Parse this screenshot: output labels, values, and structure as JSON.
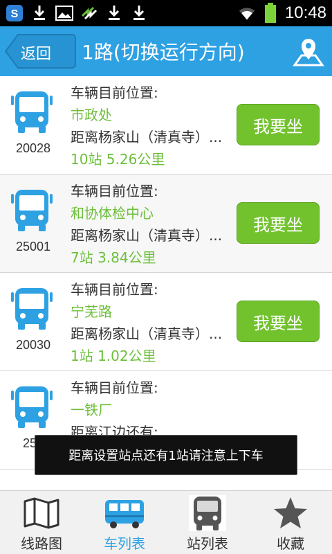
{
  "status_bar": {
    "time": "10:48",
    "icons": [
      "sogou-app-icon",
      "download-icon",
      "image-icon",
      "sync-icon",
      "download-icon",
      "download-icon",
      "wifi-icon",
      "battery-icon"
    ]
  },
  "header": {
    "back_label": "返回",
    "title": "1路(切换运行方向)",
    "accent_color": "#2ea1e3"
  },
  "buses": [
    {
      "label": "车辆目前位置:",
      "location": "市政处",
      "distance_text": "距离杨家山（清真寺）...",
      "stats": "10站  5.26公里",
      "bus_no": "20028",
      "button": "我要坐"
    },
    {
      "label": "车辆目前位置:",
      "location": "和协体检中心",
      "distance_text": "距离杨家山（清真寺）...",
      "stats": "7站  3.84公里",
      "bus_no": "25001",
      "button": "我要坐"
    },
    {
      "label": "车辆目前位置:",
      "location": "宁芜路",
      "distance_text": "距离杨家山（清真寺）...",
      "stats": "1站  1.02公里",
      "bus_no": "20030",
      "button": "我要坐"
    },
    {
      "label": "车辆目前位置:",
      "location": "一铁厂",
      "distance_text": "距离江边还有:",
      "stats": "",
      "bus_no": "250",
      "button": ""
    }
  ],
  "toast": "距离设置站点还有1站请注意上下车",
  "tabs": [
    {
      "label": "线路图",
      "icon": "map-icon",
      "active": false
    },
    {
      "label": "车列表",
      "icon": "bus-list-icon",
      "active": true
    },
    {
      "label": "站列表",
      "icon": "station-bus-icon",
      "active": false
    },
    {
      "label": "收藏",
      "icon": "star-icon",
      "active": false
    }
  ],
  "colors": {
    "title_bar": "#2ea1e3",
    "location_text": "#6cbf3a",
    "ride_button": "#72c22e"
  }
}
